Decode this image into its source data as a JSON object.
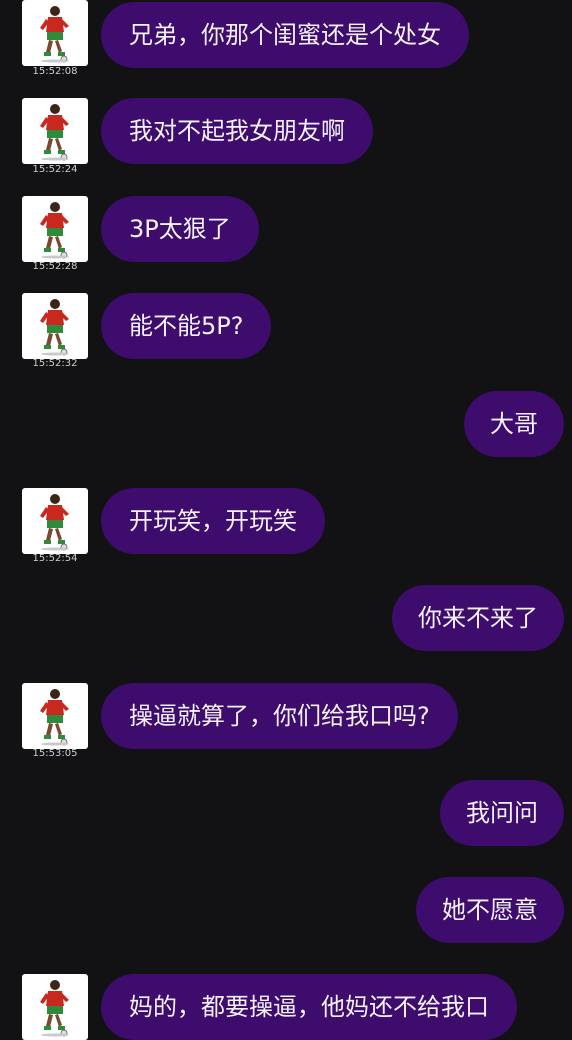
{
  "colors": {
    "background": "#121113",
    "bubble": "#3d0c6d",
    "bubble_text": "#f4f2f6",
    "timestamp": "#cfcfcf"
  },
  "avatar_icon": "soccer-player-icon",
  "messages": [
    {
      "side": "left",
      "text": "兄弟，你那个闺蜜还是个处女",
      "time": "15:52:08"
    },
    {
      "side": "left",
      "text": "我对不起我女朋友啊",
      "time": "15:52:24"
    },
    {
      "side": "left",
      "text": "3P太狠了",
      "time": "15:52:28"
    },
    {
      "side": "left",
      "text": "能不能5P?",
      "time": "15:52:32"
    },
    {
      "side": "right",
      "text": "大哥"
    },
    {
      "side": "left",
      "text": "开玩笑，开玩笑",
      "time": "15:52:54"
    },
    {
      "side": "right",
      "text": "你来不来了"
    },
    {
      "side": "left",
      "text": "操逼就算了，你们给我口吗?",
      "time": "15:53:05"
    },
    {
      "side": "right",
      "text": "我问问"
    },
    {
      "side": "right",
      "text": "她不愿意"
    },
    {
      "side": "left",
      "text": "妈的，都要操逼，他妈还不给我口"
    }
  ]
}
